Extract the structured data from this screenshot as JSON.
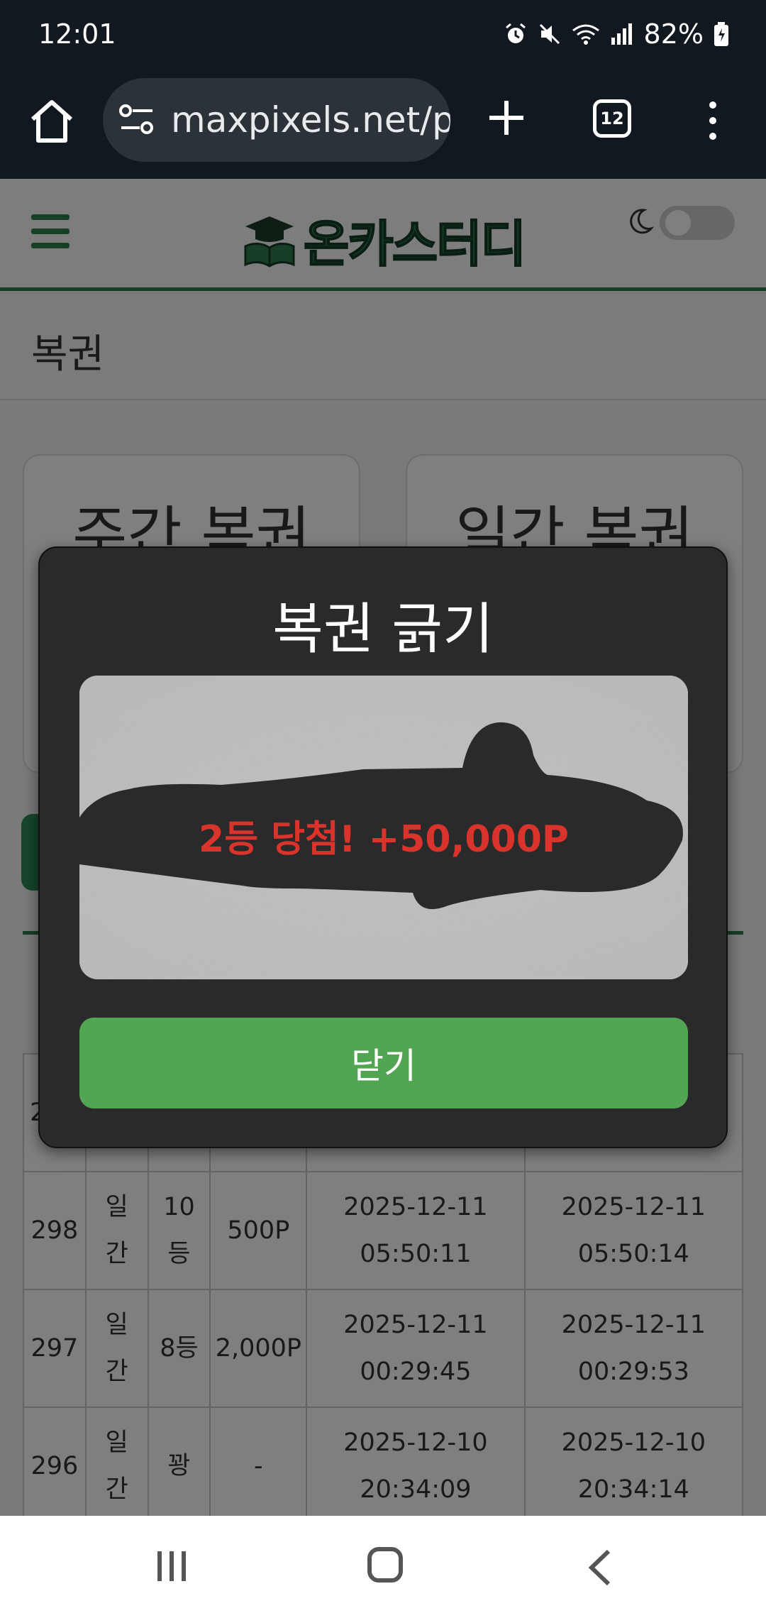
{
  "status_bar": {
    "time": "12:01",
    "battery": "82%",
    "icons": [
      "alarm-icon",
      "mute-icon",
      "wifi-icon",
      "signal-icon",
      "battery-icon"
    ]
  },
  "browser": {
    "url": "maxpixels.net/p",
    "tab_count": "12"
  },
  "site": {
    "logo_text": "온카스터디",
    "dark_mode": false
  },
  "page": {
    "section_title": "복권",
    "cards": [
      {
        "title": "주간 복권"
      },
      {
        "title": "일간 복권"
      }
    ],
    "table_rows": [
      {
        "id": "298",
        "type": "일간",
        "rank": "10등",
        "prize": "500P",
        "issued": "2025-12-11 05:50:11",
        "scratched": "2025-12-11 05:50:14"
      },
      {
        "id": "297",
        "type": "일간",
        "rank": "8등",
        "prize": "2,000P",
        "issued": "2025-12-11 00:29:45",
        "scratched": "2025-12-11 00:29:53"
      },
      {
        "id": "296",
        "type": "일간",
        "rank": "꽝",
        "prize": "-",
        "issued": "2025-12-10 20:34:09",
        "scratched": "2025-12-10 20:34:14"
      }
    ],
    "partial_row_id_char": "2"
  },
  "modal": {
    "title": "복권 긁기",
    "prize_text": "2등 당첨! +50,000P",
    "close_label": "닫기"
  },
  "colors": {
    "brand_green": "#2e7d4f",
    "button_green": "#52a553",
    "prize_red": "#d9332b",
    "modal_bg": "#2a2a2a"
  }
}
